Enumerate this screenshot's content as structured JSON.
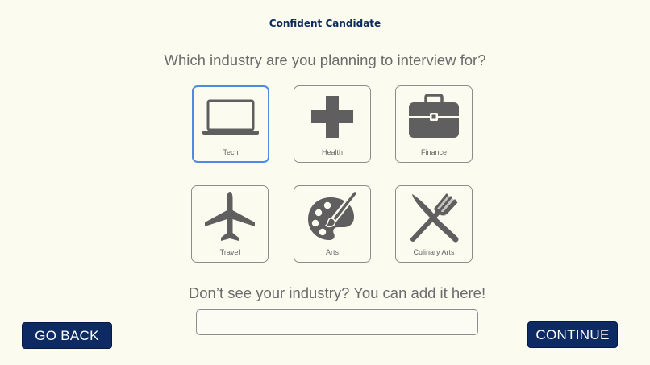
{
  "app": {
    "brand": "Confident Candidate"
  },
  "question": "Which industry are you planning to interview for?",
  "industries": [
    {
      "label": "Tech",
      "icon": "laptop-icon",
      "selected": true
    },
    {
      "label": "Health",
      "icon": "medical-cross-icon",
      "selected": false
    },
    {
      "label": "Finance",
      "icon": "briefcase-icon",
      "selected": false
    },
    {
      "label": "Travel",
      "icon": "airplane-icon",
      "selected": false
    },
    {
      "label": "Arts",
      "icon": "palette-icon",
      "selected": false
    },
    {
      "label": "Culinary Arts",
      "icon": "fork-knife-icon",
      "selected": false
    }
  ],
  "add_industry": {
    "prompt": "Don’t see your industry? You can add it here!",
    "value": "",
    "placeholder": ""
  },
  "buttons": {
    "back": "GO BACK",
    "continue": "CONTINUE"
  },
  "colors": {
    "background": "#fcfbf0",
    "brand_navy": "#0d2a63",
    "icon_gray": "#5f5f5f",
    "selected_border": "#4a8ce0"
  }
}
